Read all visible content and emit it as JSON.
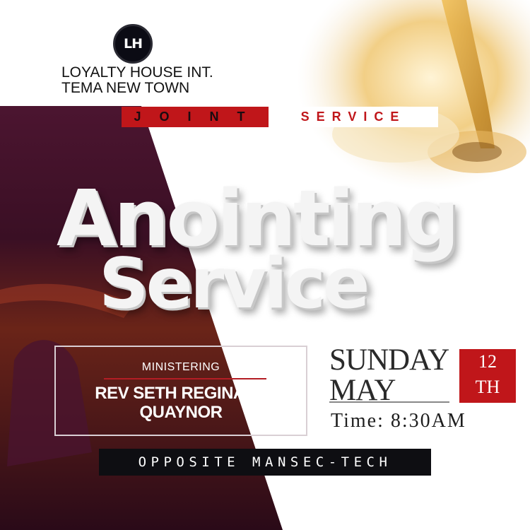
{
  "church": {
    "logo_text": "LH",
    "line1": "LOYALTY HOUSE INT.",
    "line2": "TEMA NEW TOWN"
  },
  "banner": {
    "joint": "JOINT",
    "service": "SERVICE"
  },
  "title": {
    "line1": "Anointing",
    "line2": "Service"
  },
  "ministering": {
    "label": "MINISTERING",
    "name_line1": "REV SETH REGINALD",
    "name_line2": "QUAYNOR"
  },
  "date": {
    "day": "SUNDAY",
    "month": "MAY",
    "date_number": "12",
    "date_suffix": "TH",
    "time": "Time: 8:30AM"
  },
  "location": {
    "text": "OPPOSITE MANSEC-TECH"
  },
  "colors": {
    "accent_red": "#c0161a",
    "maroon": "#3a0f24",
    "dark": "#0e0e12"
  }
}
